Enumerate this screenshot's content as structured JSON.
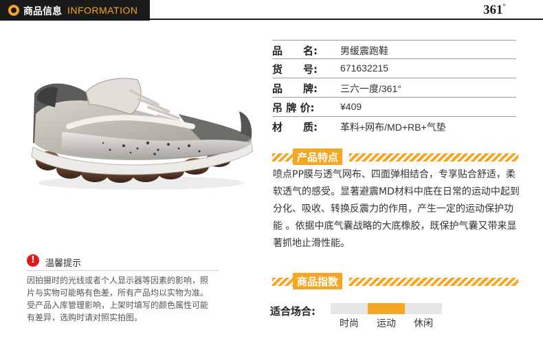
{
  "header": {
    "title": "商品信息",
    "subtitle": "INFORMATION",
    "brand": "361",
    "brand_degree": "°",
    "accent": "#f5a623",
    "dark": "#1a1a1a"
  },
  "specs": [
    {
      "label": "品　　名:",
      "value": "男缓震跑鞋"
    },
    {
      "label": "货　　号:",
      "value": "671632215"
    },
    {
      "label": "品　　牌:",
      "value": "三六一度/361°"
    },
    {
      "label": "吊 牌 价:",
      "value": "¥409"
    },
    {
      "label": "材　　质:",
      "value": "革料+网布/MD+RB+气垫"
    }
  ],
  "features": {
    "title": "产品特点",
    "text": "喷点PP膜与透气网布、四面弹相结合，专享贴合舒适，柔软透气的感受。显著避震MD材料中底在日常的运动中起到分化、吸收、转换反震力的作用，产生一定的运动保护功能 。依据中底气囊战略的大底橡胶，既保护气囊又带来显著抓地止滑性能。"
  },
  "index": {
    "title": "商品指数",
    "label": "适合场合:",
    "options": [
      "时尚",
      "运动",
      "休闲"
    ],
    "selected": "运动"
  },
  "tips": {
    "icon": "exclamation-icon",
    "title": "温馨提示",
    "text": "因拍摄时的光线或者个人显示器等因素的影响，照片与实物可能略有色差，所有产品均以实物为准。受产品入库管理影响，上架时填写的颜色属性可能有差异，选购时请对照实拍图。"
  }
}
